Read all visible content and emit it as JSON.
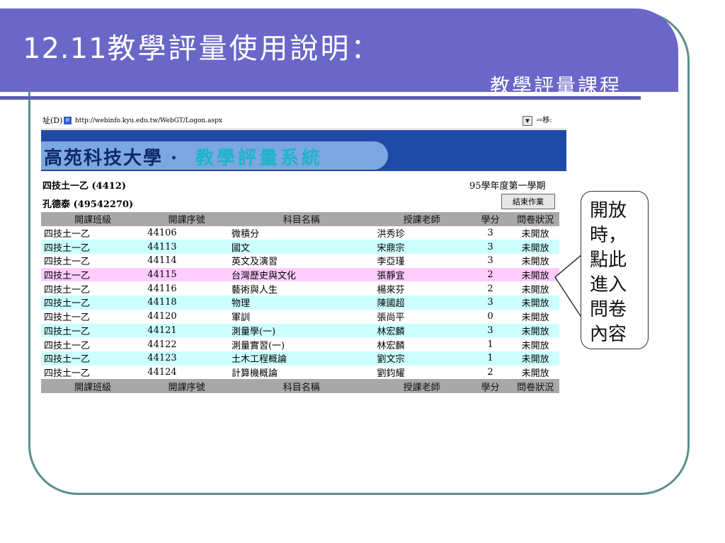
{
  "slide": {
    "title_prefix": "12.11",
    "title_main": "教學評量使用說明：",
    "subtitle": "教學評量課程",
    "callout_lines": [
      "開放",
      "時，",
      "點此",
      "進入",
      "問卷",
      "內容"
    ]
  },
  "browser": {
    "address_label": "址(D)",
    "url": "http://webinfo.kyu.edu.tw/WebGT/Logon.aspx",
    "go_label": "移:"
  },
  "app": {
    "school_name": "高苑科技大學 ·",
    "system_name": "教學評量系統",
    "class_info": "四技土一乙 (4412)",
    "student_info": "孔德泰 (49542270)",
    "term": "95學年度第一學期",
    "end_button": "結束作業"
  },
  "table": {
    "headers": [
      "開課班級",
      "開課序號",
      "科目名稱",
      "授課老師",
      "學分",
      "問卷狀況"
    ],
    "rows": [
      {
        "class": "四技土一乙",
        "num": "44106",
        "subject": "微積分",
        "teacher": "洪秀珍",
        "credits": "3",
        "status": "未開放"
      },
      {
        "class": "四技土一乙",
        "num": "44113",
        "subject": "國文",
        "teacher": "宋鼎宗",
        "credits": "3",
        "status": "未開放"
      },
      {
        "class": "四技土一乙",
        "num": "44114",
        "subject": "英文及演習",
        "teacher": "李亞瑾",
        "credits": "3",
        "status": "未開放"
      },
      {
        "class": "四技土一乙",
        "num": "44115",
        "subject": "台灣歷史與文化",
        "teacher": "張靜宜",
        "credits": "2",
        "status": "未開放"
      },
      {
        "class": "四技土一乙",
        "num": "44116",
        "subject": "藝術與人生",
        "teacher": "楊來芬",
        "credits": "2",
        "status": "未開放"
      },
      {
        "class": "四技土一乙",
        "num": "44118",
        "subject": "物理",
        "teacher": "陳國超",
        "credits": "3",
        "status": "未開放"
      },
      {
        "class": "四技土一乙",
        "num": "44120",
        "subject": "軍訓",
        "teacher": "張尚平",
        "credits": "0",
        "status": "未開放"
      },
      {
        "class": "四技土一乙",
        "num": "44121",
        "subject": "測量學(一)",
        "teacher": "林宏麟",
        "credits": "3",
        "status": "未開放"
      },
      {
        "class": "四技土一乙",
        "num": "44122",
        "subject": "測量實習(一)",
        "teacher": "林宏麟",
        "credits": "1",
        "status": "未開放"
      },
      {
        "class": "四技土一乙",
        "num": "44123",
        "subject": "土木工程概論",
        "teacher": "劉文宗",
        "credits": "1",
        "status": "未開放"
      },
      {
        "class": "四技土一乙",
        "num": "44124",
        "subject": "計算機概論",
        "teacher": "劉鈞耀",
        "credits": "2",
        "status": "未開放"
      }
    ],
    "row_styles": [
      "row-plain",
      "row-alt",
      "row-plain",
      "row-hl",
      "row-plain",
      "row-alt",
      "row-plain",
      "row-alt",
      "row-plain",
      "row-alt",
      "row-plain"
    ]
  }
}
